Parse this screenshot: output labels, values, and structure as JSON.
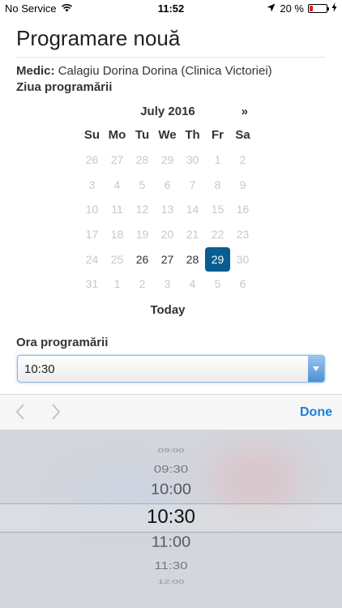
{
  "status_bar": {
    "carrier": "No Service",
    "time": "11:52",
    "battery_percent": "20 %",
    "battery_level": 0.2
  },
  "page": {
    "title": "Programare nouă",
    "doctor_label": "Medic:",
    "doctor_value": "Calagiu Dorina Dorina (Clinica Victoriei)",
    "date_label": "Ziua programării",
    "time_label": "Ora programării"
  },
  "calendar": {
    "month_title": "July 2016",
    "next_label": "»",
    "weekdays": [
      "Su",
      "Mo",
      "Tu",
      "We",
      "Th",
      "Fr",
      "Sa"
    ],
    "weeks": [
      [
        {
          "d": "26",
          "dim": true
        },
        {
          "d": "27",
          "dim": true
        },
        {
          "d": "28",
          "dim": true
        },
        {
          "d": "29",
          "dim": true
        },
        {
          "d": "30",
          "dim": true
        },
        {
          "d": "1",
          "dim": true
        },
        {
          "d": "2",
          "dim": true
        }
      ],
      [
        {
          "d": "3",
          "dim": true
        },
        {
          "d": "4",
          "dim": true
        },
        {
          "d": "5",
          "dim": true
        },
        {
          "d": "6",
          "dim": true
        },
        {
          "d": "7",
          "dim": true
        },
        {
          "d": "8",
          "dim": true
        },
        {
          "d": "9",
          "dim": true
        }
      ],
      [
        {
          "d": "10",
          "dim": true
        },
        {
          "d": "11",
          "dim": true
        },
        {
          "d": "12",
          "dim": true
        },
        {
          "d": "13",
          "dim": true
        },
        {
          "d": "14",
          "dim": true
        },
        {
          "d": "15",
          "dim": true
        },
        {
          "d": "16",
          "dim": true
        }
      ],
      [
        {
          "d": "17",
          "dim": true
        },
        {
          "d": "18",
          "dim": true
        },
        {
          "d": "19",
          "dim": true
        },
        {
          "d": "20",
          "dim": true
        },
        {
          "d": "21",
          "dim": true
        },
        {
          "d": "22",
          "dim": true
        },
        {
          "d": "23",
          "dim": true
        }
      ],
      [
        {
          "d": "24",
          "dim": true
        },
        {
          "d": "25",
          "dim": true
        },
        {
          "d": "26",
          "dim": false
        },
        {
          "d": "27",
          "dim": false
        },
        {
          "d": "28",
          "dim": false
        },
        {
          "d": "29",
          "dim": false,
          "selected": true
        },
        {
          "d": "30",
          "dim": true
        }
      ],
      [
        {
          "d": "31",
          "dim": true
        },
        {
          "d": "1",
          "dim": true
        },
        {
          "d": "2",
          "dim": true
        },
        {
          "d": "3",
          "dim": true
        },
        {
          "d": "4",
          "dim": true
        },
        {
          "d": "5",
          "dim": true
        },
        {
          "d": "6",
          "dim": true
        }
      ]
    ],
    "today_label": "Today"
  },
  "time_select": {
    "value": "10:30"
  },
  "accessory_bar": {
    "done_label": "Done"
  },
  "picker": {
    "options": [
      "09:00",
      "09:30",
      "10:00",
      "10:30",
      "11:00",
      "11:30",
      "12:00"
    ],
    "selected": "10:30"
  },
  "colors": {
    "selected_day": "#0a5d92",
    "done": "#1b7fd8",
    "battery": "#e3221c"
  }
}
